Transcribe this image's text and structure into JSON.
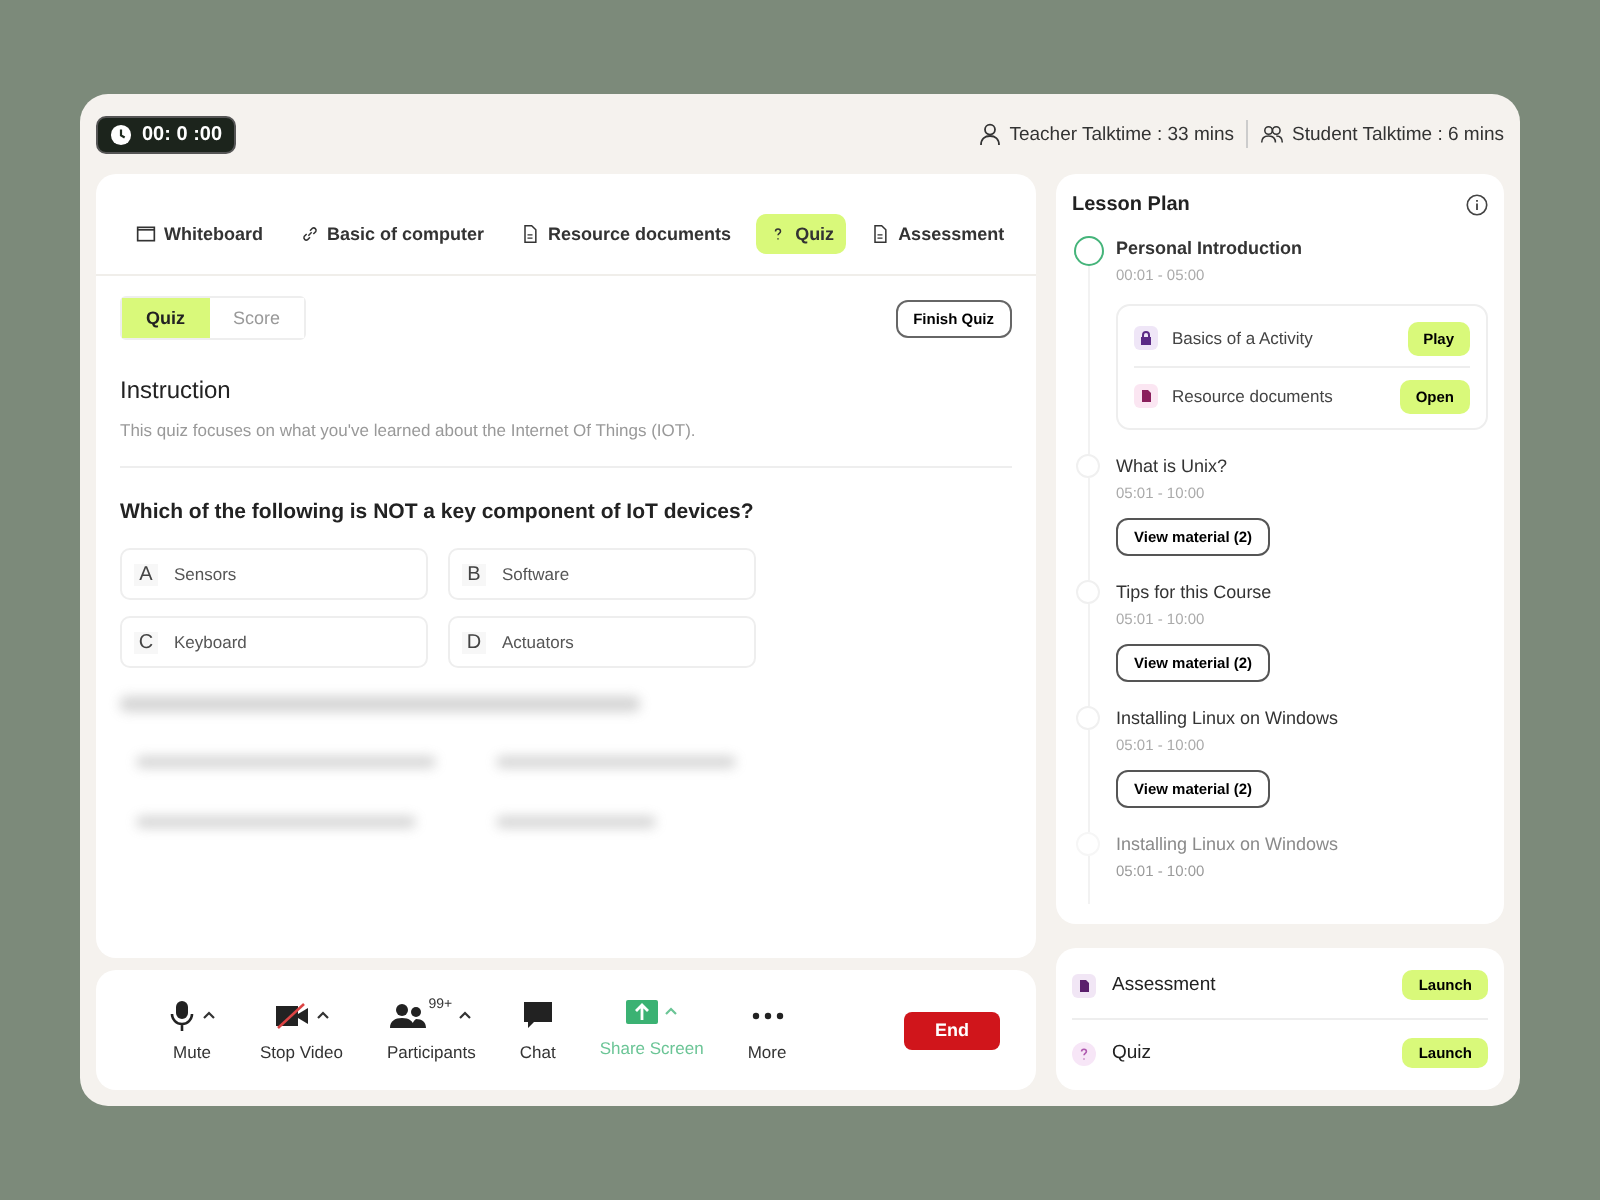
{
  "timer": "00: 0 :00",
  "talktime": [
    {
      "kind": "teacher",
      "text": "Teacher Talktime : 33 mins"
    },
    {
      "kind": "student",
      "text": "Student Talktime : 6 mins"
    }
  ],
  "tabs": [
    {
      "kind": "window",
      "label": "Whiteboard",
      "selected": false
    },
    {
      "kind": "link",
      "label": "Basic of computer",
      "selected": false
    },
    {
      "kind": "doc",
      "label": "Resource documents",
      "selected": false
    },
    {
      "kind": "question",
      "label": "Quiz",
      "selected": true
    },
    {
      "kind": "doc",
      "label": "Assessment",
      "selected": false
    }
  ],
  "subtabs": [
    {
      "label": "Quiz",
      "selected": true
    },
    {
      "label": "Score",
      "selected": false
    }
  ],
  "finish_button": "Finish Quiz",
  "instruction": {
    "title": "Instruction",
    "text": "This quiz focuses on what you've learned about the Internet Of Things (IOT)."
  },
  "question": {
    "text": "Which of the following is NOT a key component of IoT devices?",
    "options": [
      {
        "letter": "A",
        "text": "Sensors"
      },
      {
        "letter": "B",
        "text": "Software"
      },
      {
        "letter": "C",
        "text": "Keyboard"
      },
      {
        "letter": "D",
        "text": "Actuators"
      }
    ]
  },
  "toolbar": {
    "items": [
      {
        "kind": "mic",
        "label": "Mute",
        "caret": true,
        "active": false
      },
      {
        "kind": "video",
        "label": "Stop Video",
        "caret": true,
        "active": false
      },
      {
        "kind": "people",
        "label": "Participants",
        "badge": "99+",
        "caret": true,
        "active": false
      },
      {
        "kind": "chat",
        "label": "Chat",
        "caret": false,
        "active": false
      },
      {
        "kind": "share",
        "label": "Share Screen",
        "caret": true,
        "active": true
      },
      {
        "kind": "more",
        "label": "More",
        "caret": false,
        "active": false
      }
    ],
    "end_button": "End"
  },
  "lesson_plan": {
    "title": "Lesson Plan",
    "items": [
      {
        "title": "Personal Introduction",
        "time": "00:01 - 05:00",
        "current": true,
        "faded": false,
        "activities": [
          {
            "kind": "lock",
            "label": "Basics of a Activity",
            "button": "Play"
          },
          {
            "kind": "doc",
            "label": "Resource documents",
            "button": "Open"
          }
        ]
      },
      {
        "title": "What is Unix?",
        "time": "05:01 - 10:00",
        "current": false,
        "faded": false,
        "material_button": "View material (2)"
      },
      {
        "title": "Tips for this Course",
        "time": "05:01 - 10:00",
        "current": false,
        "faded": false,
        "material_button": "View material (2)"
      },
      {
        "title": "Installing Linux on Windows",
        "time": "05:01 - 10:00",
        "current": false,
        "faded": false,
        "material_button": "View material (2)"
      },
      {
        "title": "Installing Linux on Windows",
        "time": "05:01 - 10:00",
        "current": false,
        "faded": true
      }
    ]
  },
  "launchers": [
    {
      "kind": "doc",
      "label": "Assessment",
      "button": "Launch"
    },
    {
      "kind": "question",
      "label": "Quiz",
      "button": "Launch"
    }
  ]
}
